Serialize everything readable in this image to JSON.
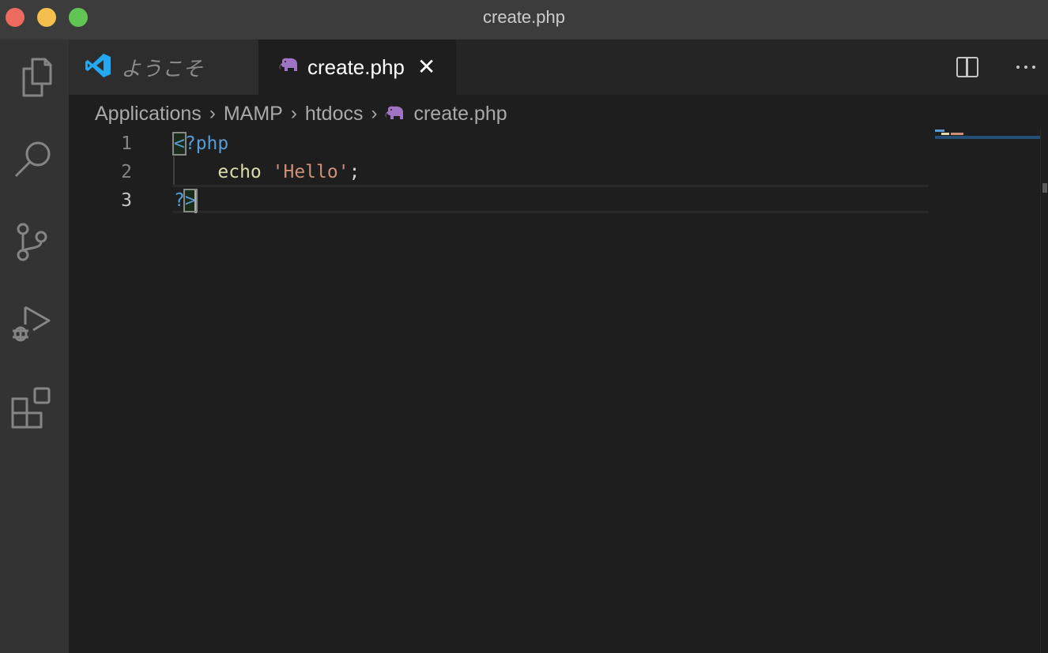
{
  "window": {
    "title": "create.php"
  },
  "activity_bar": {
    "items": [
      {
        "name": "explorer",
        "icon": "files-icon"
      },
      {
        "name": "search",
        "icon": "search-icon"
      },
      {
        "name": "source-control",
        "icon": "source-control-icon"
      },
      {
        "name": "run-and-debug",
        "icon": "run-debug-icon"
      },
      {
        "name": "extensions",
        "icon": "extensions-icon"
      }
    ]
  },
  "tabs": [
    {
      "label": "ようこそ",
      "icon": "vscode-logo-icon",
      "active": false
    },
    {
      "label": "create.php",
      "icon": "php-elephant-icon",
      "active": true,
      "close": "✕"
    }
  ],
  "tab_actions": {
    "split": "split-editor-icon",
    "more": "more-actions-icon"
  },
  "breadcrumb": {
    "items": [
      "Applications",
      "MAMP",
      "htdocs",
      "create.php"
    ],
    "separator": "›"
  },
  "editor": {
    "current_line": 3,
    "lines": [
      {
        "number": "1",
        "tokens": [
          {
            "type": "tag",
            "text": "<?php"
          }
        ]
      },
      {
        "number": "2",
        "tokens": [
          {
            "type": "plain",
            "text": "    "
          },
          {
            "type": "fn",
            "text": "echo"
          },
          {
            "type": "plain",
            "text": " "
          },
          {
            "type": "str",
            "text": "'Hello'"
          },
          {
            "type": "plain",
            "text": ";"
          }
        ]
      },
      {
        "number": "3",
        "tokens": [
          {
            "type": "tag",
            "text": "?>"
          }
        ]
      }
    ]
  },
  "colors": {
    "keyword_tag": "#569cd6",
    "function": "#dcdcaa",
    "string": "#ce9178",
    "php_icon": "#a074c4",
    "vscode_blue": "#23a9f2"
  }
}
